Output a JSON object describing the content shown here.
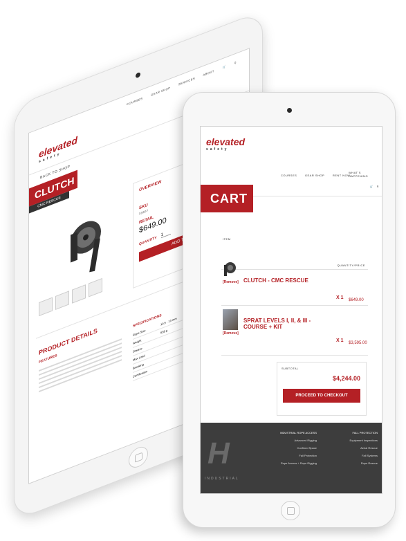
{
  "back_tablet": {
    "nav": [
      "COURSES",
      "GEAR SHOP",
      "SERVICES",
      "ABOUT"
    ],
    "logo": {
      "brand": "elevated",
      "sub": "safety"
    },
    "breadcrumb": "BACK TO SHOP",
    "product": {
      "title": "CLUTCH",
      "subtitle": "CMC RESCUE",
      "overview_label": "OVERVIEW",
      "sku_label": "SKU",
      "sku_value": "33507",
      "retail_label": "RETAIL",
      "price": "$649.00",
      "quantity_label": "QUANTITY",
      "quantity_value": "1",
      "add_to_cart": "ADD TO CART"
    },
    "details": {
      "title": "PRODUCT DETAILS",
      "features_label": "FEATURES",
      "specs_label": "SPECIFICATIONS",
      "specs": [
        {
          "k": "Rope Size",
          "v": "10.5 - 13 mm"
        },
        {
          "k": "Weight",
          "v": "538 g"
        },
        {
          "k": "Sheave",
          "v": ""
        },
        {
          "k": "Max Load",
          "v": ""
        },
        {
          "k": "Breaking",
          "v": ""
        },
        {
          "k": "Certification",
          "v": ""
        }
      ]
    }
  },
  "front_tablet": {
    "logo": {
      "brand": "elevated",
      "sub": "safety"
    },
    "nav": [
      "COURSES",
      "GEAR SHOP",
      "RENT NOW",
      "WHAT'S HAPPENING"
    ],
    "cart_label": "CART",
    "cart_title": "CART",
    "items_label": "ITEM",
    "quantity_label": "QUANTITY/PRICE",
    "items": [
      {
        "name": "CLUTCH - CMC RESCUE",
        "remove": "[Remove]",
        "qty": "X 1",
        "price": "$649.00"
      },
      {
        "name": "SPRAT LEVELS I, II, & III - COURSE + KIT",
        "remove": "[Remove]",
        "qty": "X 1",
        "price": "$3,595.00"
      }
    ],
    "subtotal_label": "SUBTOTAL",
    "subtotal": "$4,244.00",
    "checkout": "PROCEED TO CHECKOUT",
    "footer": {
      "brand": "INDUSTRIAL",
      "col1_title": "INDUSTRIAL ROPE ACCESS",
      "col1": [
        "Advanced Rigging",
        "Confined Space",
        "Fall Protection",
        "Rope Access + Rope Rigging"
      ],
      "col2_title": "FALL PROTECTION",
      "col2": [
        "Equipment Inspections",
        "Aerial Rescue",
        "Fall Systems",
        "Rope Rescue"
      ]
    }
  }
}
